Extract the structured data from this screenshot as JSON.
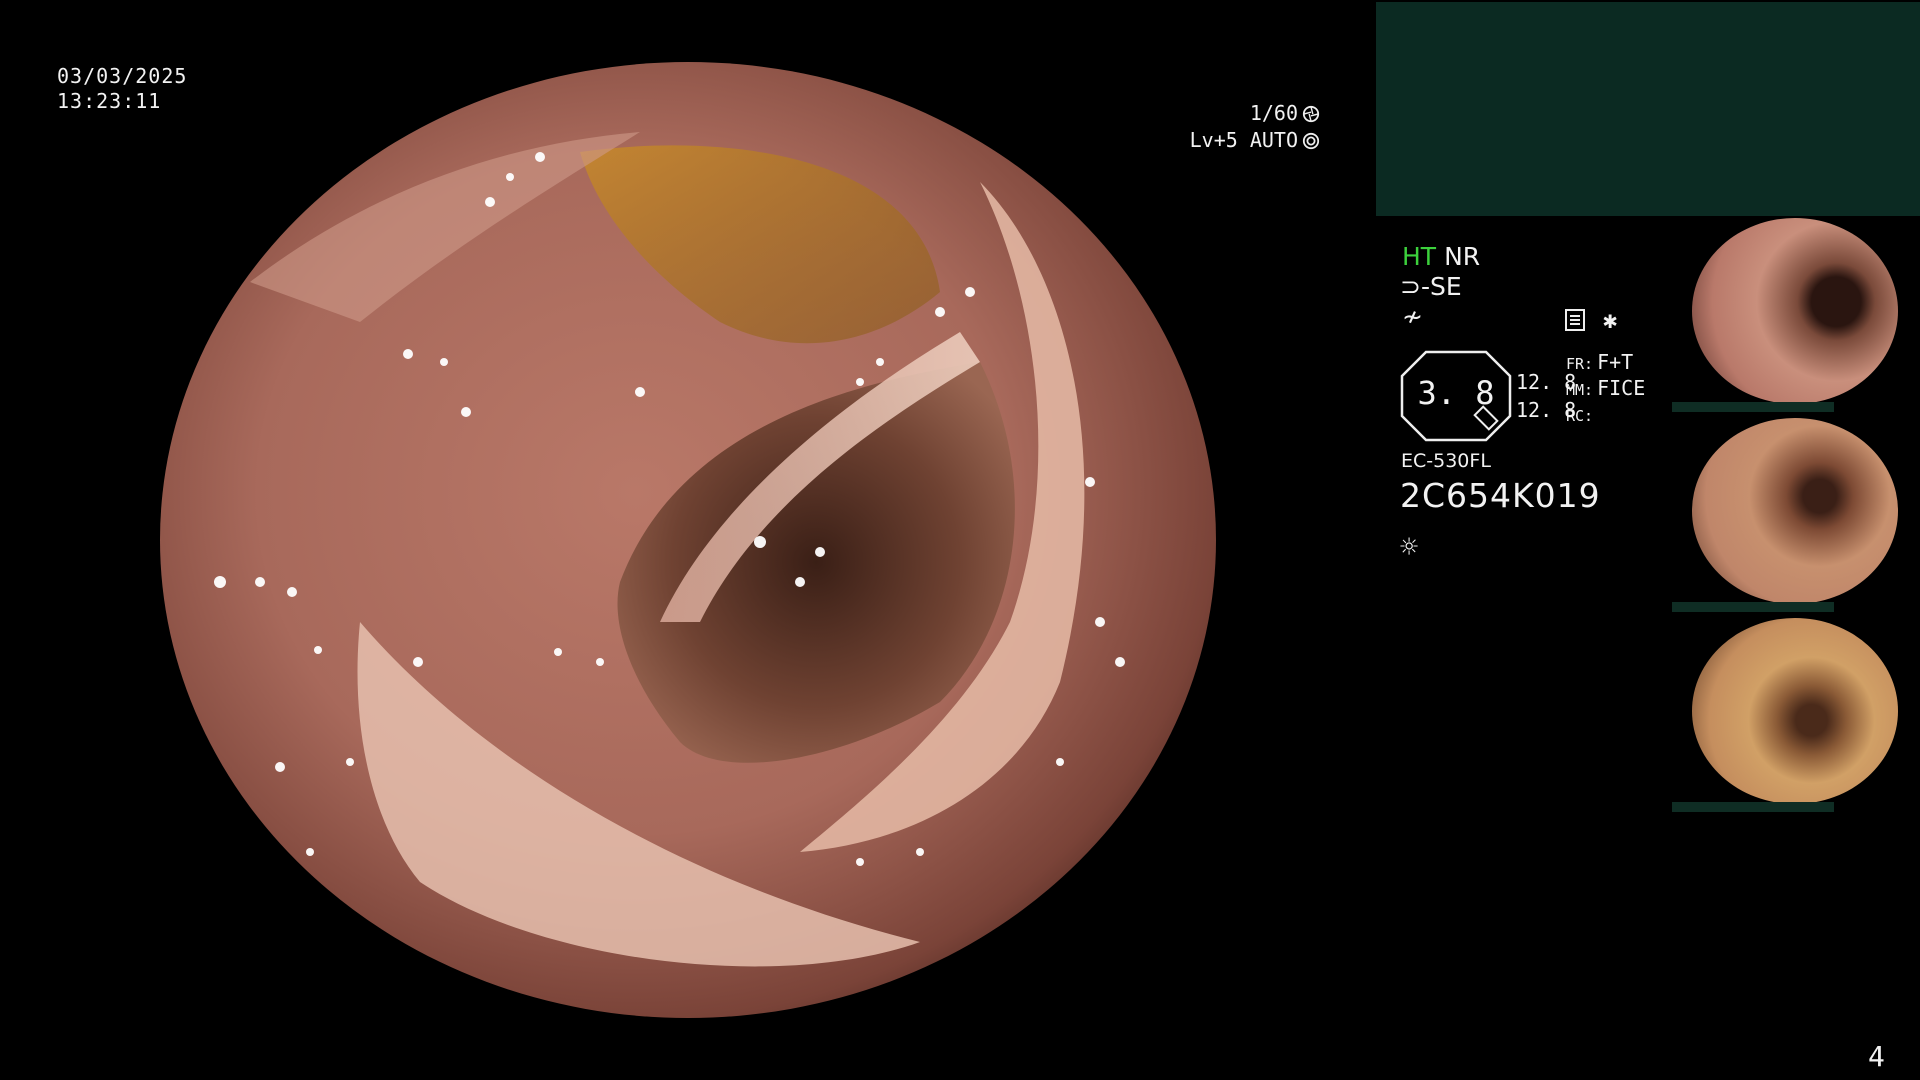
{
  "overlay": {
    "date": "03/03/2025",
    "time": "13:23:11",
    "shutter_speed": "1/60",
    "iris_level": "Lv+5 AUTO",
    "page_number": "4"
  },
  "panel": {
    "ht_label": "HT",
    "nr_label": "NR",
    "se_label": "SE",
    "current_symbol": "≁",
    "star_symbol": "✱",
    "gauge_value": "3. 8",
    "numbers": [
      "12. 8",
      "12. 8"
    ],
    "params": [
      {
        "label": "FR:",
        "value": "F+T"
      },
      {
        "label": "MM:",
        "value": "FICE"
      },
      {
        "label": "RC:",
        "value": ""
      }
    ],
    "model": "EC-530FL",
    "serial": "2C654K019",
    "sun_symbol": "☼"
  },
  "icons": {
    "shutter": "shutter-aperture-icon",
    "auto_iris": "auto-iris-icon",
    "doc": "document-list-icon",
    "light": "light-sun-icon"
  },
  "colors": {
    "ht": "#3cd13c",
    "panel_teal": "#0b2a22",
    "tissue": "#b97868"
  }
}
